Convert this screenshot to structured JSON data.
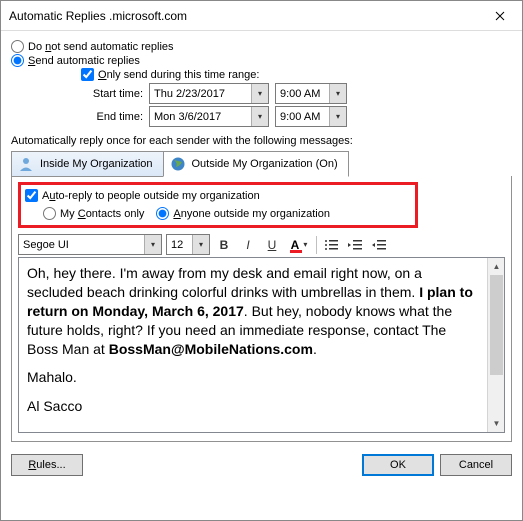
{
  "title": "Automatic Replies         .microsoft.com",
  "options": {
    "do_not_send": "Do not send automatic replies",
    "send": "Send automatic replies",
    "only_send_range": "Only send during this time range:",
    "start_label": "Start time:",
    "end_label": "End time:",
    "start_date": "Thu 2/23/2017",
    "start_time": "9:00 AM",
    "end_date": "Mon 3/6/2017",
    "end_time": "9:00 AM"
  },
  "section_heading": "Automatically reply once for each sender with the following messages:",
  "tabs": {
    "inside": "Inside My Organization",
    "outside": "Outside My Organization (On)"
  },
  "outside_panel": {
    "auto_reply_check": "Auto-reply to people outside my organization",
    "my_contacts": "My Contacts only",
    "anyone": "Anyone outside my organization"
  },
  "toolbar": {
    "font": "Segoe UI",
    "size": "12"
  },
  "editor": {
    "p1a": "Oh, hey there. I'm away from my desk and email right now, on a secluded beach drinking colorful drinks with umbrellas in them. ",
    "p1b": "I plan to return on Monday, March 6, 2017",
    "p1c": ". But hey, nobody knows what the future holds, right? If you need an immediate response, contact The Boss Man at ",
    "p1d": "BossMan@MobileNations.com",
    "p1e": ".",
    "p2": "Mahalo.",
    "p3": "Al Sacco"
  },
  "footer": {
    "rules": "Rules...",
    "ok": "OK",
    "cancel": "Cancel"
  }
}
